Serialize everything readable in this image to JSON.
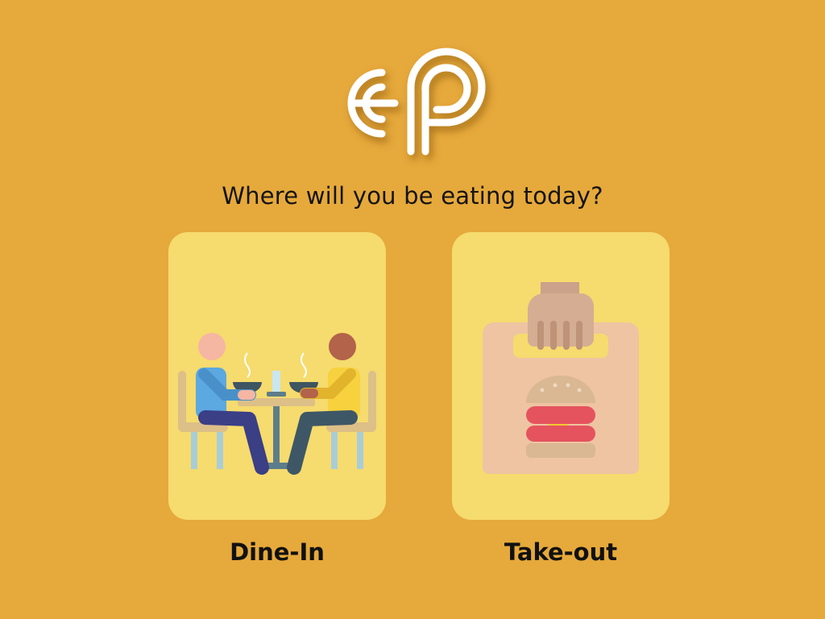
{
  "prompt": {
    "question": "Where will you be eating today?"
  },
  "options": [
    {
      "id": "dine-in",
      "label": "Dine-In",
      "icon": "dine-in-icon"
    },
    {
      "id": "take-out",
      "label": "Take-out",
      "icon": "takeout-bag-icon"
    }
  ],
  "colors": {
    "background": "#E6A93B",
    "card": "#F6DB6E",
    "logo": "#FFFFFF"
  }
}
